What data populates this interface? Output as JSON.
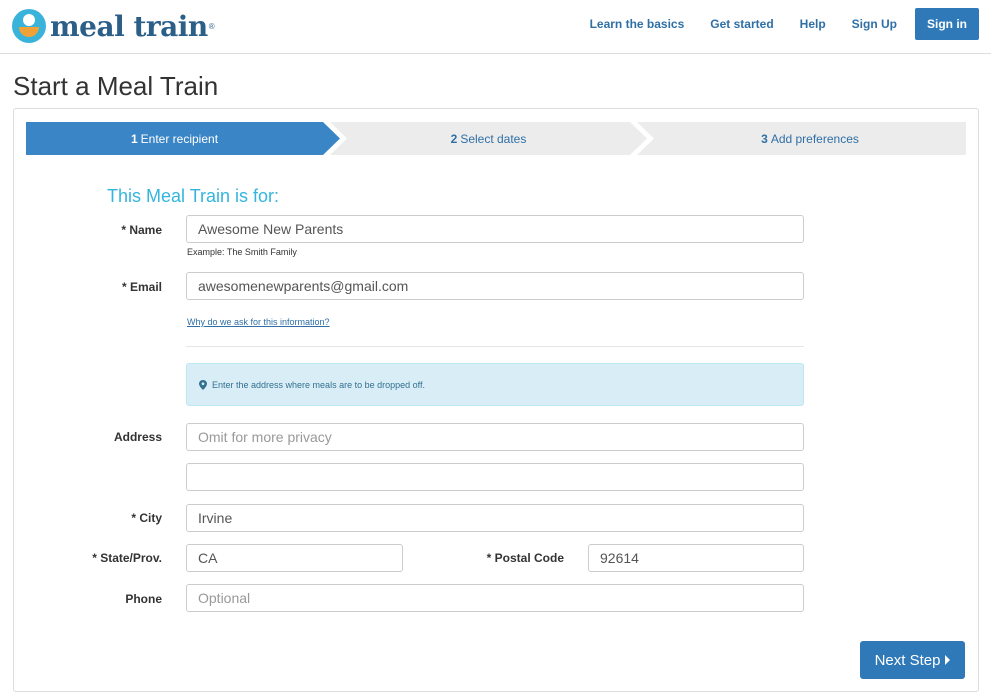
{
  "header": {
    "logo_text": "meal train",
    "logo_reg": "®",
    "nav": {
      "learn": "Learn the basics",
      "started": "Get started",
      "help": "Help",
      "signup": "Sign Up",
      "signin": "Sign in"
    }
  },
  "page_title": "Start a Meal Train",
  "stepper": {
    "steps": [
      {
        "num": "1",
        "label": "Enter recipient",
        "active": true
      },
      {
        "num": "2",
        "label": "Select dates",
        "active": false
      },
      {
        "num": "3",
        "label": "Add preferences",
        "active": false
      }
    ]
  },
  "form": {
    "heading": "This Meal Train is for:",
    "name": {
      "label": "* Name",
      "value": "Awesome New Parents",
      "help": "Example: The Smith Family"
    },
    "email": {
      "label": "* Email",
      "value": "awesomenewparents@gmail.com",
      "link": "Why do we ask for this information?"
    },
    "alert": "Enter the address where meals are to be dropped off.",
    "address": {
      "label": "Address",
      "placeholder": "Omit for more privacy",
      "line2": ""
    },
    "city": {
      "label": "* City",
      "value": "Irvine"
    },
    "state": {
      "label": "* State/Prov.",
      "value": "CA"
    },
    "postal": {
      "label": "* Postal Code",
      "value": "92614"
    },
    "phone": {
      "label": "Phone",
      "placeholder": "Optional"
    }
  },
  "next_button": "Next Step",
  "colors": {
    "primary": "#2f79b8",
    "heading_accent": "#33b5dd",
    "step_inactive_bg": "#ececec",
    "step_active_bg": "#3a85c6",
    "alert_bg": "#d9edf7"
  },
  "icons": {
    "logo": "meal-train-logo-icon",
    "alert": "map-marker-icon",
    "next": "caret-right-icon"
  }
}
